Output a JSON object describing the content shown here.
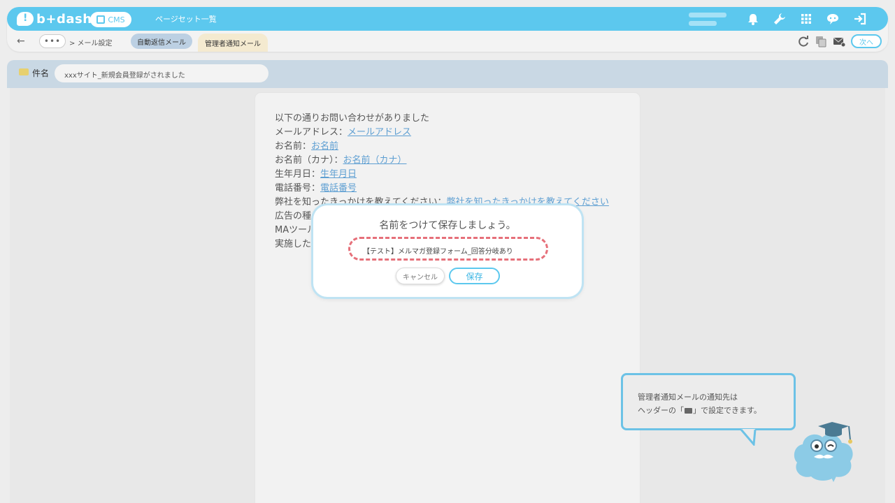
{
  "header": {
    "logo_text": "b+dash",
    "cms_label": "CMS",
    "title": "ページセット一覧",
    "icons": [
      "bell-icon",
      "wrench-icon",
      "grid-icon",
      "chat-icon",
      "logout-icon"
    ]
  },
  "subheader": {
    "back_label": "←",
    "more_label": "•••",
    "breadcrumb": "> メール設定",
    "tabs": [
      {
        "label": "自動返信メール"
      },
      {
        "label": "管理者通知メール"
      }
    ],
    "next_label": "次へ",
    "right_icons": [
      "refresh-icon",
      "copy-settings-icon",
      "mail-settings-icon"
    ]
  },
  "subject": {
    "label": "件名",
    "value": "xxxサイト_新規会員登録がされました"
  },
  "mail_body": {
    "intro": "以下の通りお問い合わせがありました",
    "fields": [
      {
        "label": "メールアドレス：",
        "link": "メールアドレス"
      },
      {
        "label": "お名前：",
        "link": "お名前"
      },
      {
        "label": "お名前（カナ）：",
        "link": "お名前（カナ）"
      },
      {
        "label": "生年月日：",
        "link": "生年月日"
      },
      {
        "label": "電話番号：",
        "link": "電話番号"
      },
      {
        "label": "弊社を知ったきっかけを教えてください：",
        "link": "弊社を知ったきっかけを教えてください"
      }
    ],
    "partial_lines": [
      "広告の種",
      "MAツール",
      "実施した"
    ]
  },
  "modal": {
    "title": "名前をつけて保存しましょう。",
    "input_value": "【テスト】メルマガ登録フォーム_回答分岐あり",
    "cancel_label": "キャンセル",
    "save_label": "保存"
  },
  "tooltip": {
    "line1": "管理者通知メールの通知先は",
    "line2": "ヘッダーの「",
    "line2_end": "」で設定できます。"
  },
  "colors": {
    "brand": "#5cc8ee",
    "highlight_dash": "#e6707a",
    "link": "#5e9fd2"
  }
}
